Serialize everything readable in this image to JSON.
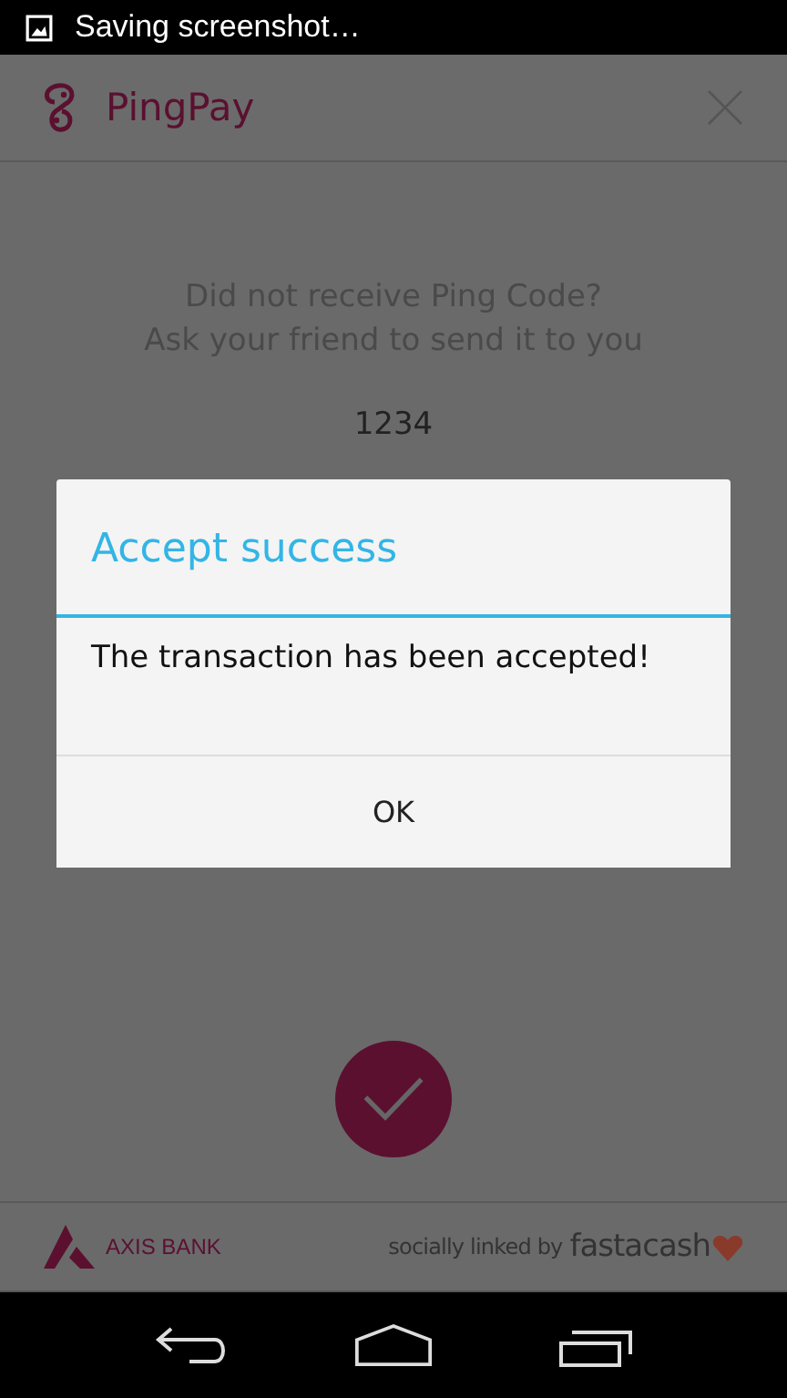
{
  "status_bar": {
    "notification": "Saving screenshot…"
  },
  "app_bar": {
    "title": "PingPay"
  },
  "prompt": {
    "lines": [
      "Did not receive Ping Code?",
      "Ask your friend to send it to you"
    ]
  },
  "code": "1234",
  "dialog": {
    "title": "Accept success",
    "message": "The transaction has been accepted!",
    "button": "OK"
  },
  "footer": {
    "bank": "AXIS BANK",
    "tagline": "socially linked by",
    "brand": "fastacash"
  }
}
